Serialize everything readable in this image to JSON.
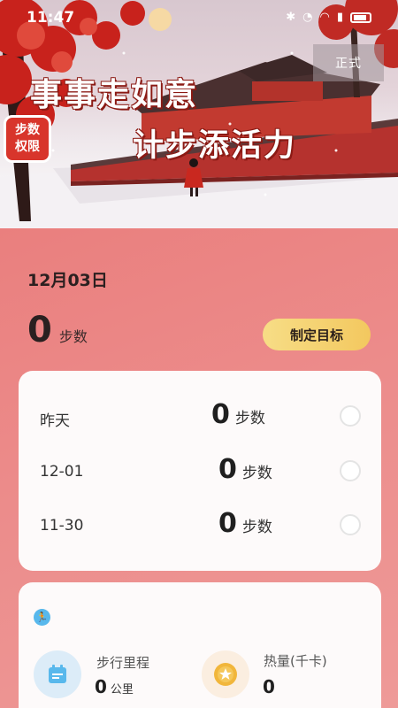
{
  "status_bar": {
    "time": "11:47"
  },
  "banner": {
    "mode_tag": "正式",
    "slogan_line1": "事事走如意",
    "slogan_line2": "计步添活力",
    "badge_line1": "步数",
    "badge_line2": "权限"
  },
  "today": {
    "date": "12月03日",
    "steps": "0",
    "unit": "步数",
    "goal_button": "制定目标"
  },
  "history": [
    {
      "label": "昨天",
      "steps": "0",
      "unit": "步数"
    },
    {
      "label": "12-01",
      "steps": "0",
      "unit": "步数"
    },
    {
      "label": "11-30",
      "steps": "0",
      "unit": "步数"
    }
  ],
  "stats": {
    "distance": {
      "title": "步行里程",
      "value": "0",
      "unit": "公里"
    },
    "calories": {
      "title": "热量(千卡)",
      "value": "0"
    }
  },
  "colors": {
    "accent_red": "#d8352b",
    "background": "#ec8c8b",
    "goal_button": "#f3c85f",
    "card": "#fdfafa",
    "distance_icon": "#58b8ec",
    "calorie_icon": "#f1b63b"
  }
}
